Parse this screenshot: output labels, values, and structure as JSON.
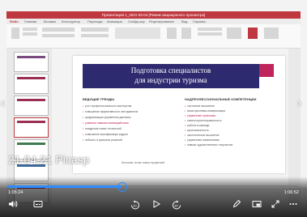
{
  "window": {
    "title": "Презентация 1_2021-03-04 [Режим защищенного просмотра]"
  },
  "ribbon_tabs": [
    "Файл",
    "Главная",
    "Вставка",
    "Конструктор",
    "Переходы",
    "Анимация",
    "Слайд-шоу",
    "Рецензирование",
    "Вид",
    "Справка"
  ],
  "slide": {
    "title_line1": "Подготовка специалистов",
    "title_line2": "для индустрии туризма",
    "left_header": "ВЕДУЩИЕ ТРЕНДЫ",
    "right_header": "НАДПРОФЕССИОНАЛЬНЫЕ КОМПЕТЕНЦИИ",
    "left_items": [
      "рост профессионального мастерства",
      "повышение эффективности инструментов",
      "цифровизация управления данными",
      "развитие навыков взаимодействия",
      "внедрение новых технологий",
      "повышение квалификации кадров",
      "гибкость в принятии решений"
    ],
    "right_items": [
      "системное мышление",
      "межотраслевая коммуникация",
      "управление проектами",
      "клиентоориентированность",
      "работа в команде",
      "мультиязычность",
      "экологическое мышление",
      "управление изменениями",
      "навыки художественного творчества"
    ],
    "footer": "Источник: Атлас новых профессий"
  },
  "caption": "21.04.21 Picasp",
  "player": {
    "current_time": "1:05:24",
    "total_time": "1:06:52",
    "progress": 0.39
  },
  "icons": {
    "volume": "volume-icon",
    "subtitles": "subtitles-icon",
    "rewind": "rewind-10-icon",
    "play": "play-icon",
    "forward": "forward-10-icon",
    "pen": "pen-icon",
    "picture_in_picture": "pip-icon",
    "fullscreen": "fullscreen-icon",
    "more": "more-icon"
  }
}
